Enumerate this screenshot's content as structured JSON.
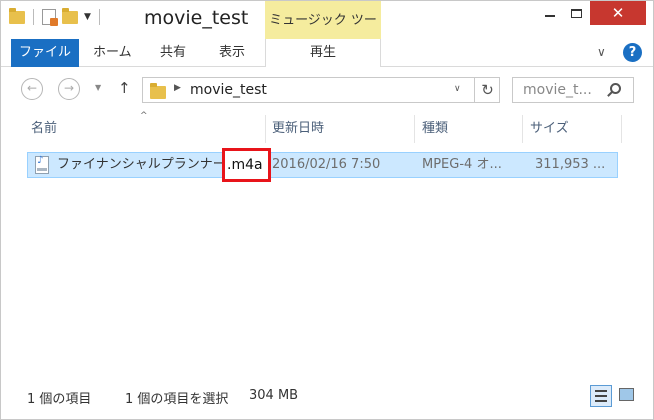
{
  "window": {
    "title": "movie_test",
    "context_tab": "ミュージック ツール",
    "close_glyph": "✕"
  },
  "ribbon": {
    "file_tab": "ファイル",
    "tabs": [
      "ホーム",
      "共有",
      "表示"
    ],
    "context_subtab": "再生",
    "help_glyph": "?",
    "collapse_glyph": "∨"
  },
  "address": {
    "path": "movie_test",
    "search_placeholder": "movie_t...",
    "back_glyph": "←",
    "forward_glyph": "→",
    "up_glyph": "↑",
    "refresh_glyph": "↻",
    "separator_glyph": "▶",
    "dropdown_glyph": "∨",
    "recent_glyph": "▼"
  },
  "columns": {
    "name": "名前",
    "date": "更新日時",
    "type": "種類",
    "size": "サイズ",
    "sort_glyph": "^"
  },
  "files": [
    {
      "name": "ファイナンシャルプランナー",
      "ext": ".m4a",
      "date": "2016/02/16 7:50",
      "type": "MPEG-4 オ...",
      "size": "311,953 ..."
    }
  ],
  "status": {
    "count": "1 個の項目",
    "selected": "1 個の項目を選択",
    "size": "304 MB"
  },
  "colors": {
    "accent": "#1a6fc3",
    "context_tab": "#f5ec9e",
    "selection": "#cce8ff",
    "highlight_box": "#e8141a",
    "close": "#c7372f"
  }
}
